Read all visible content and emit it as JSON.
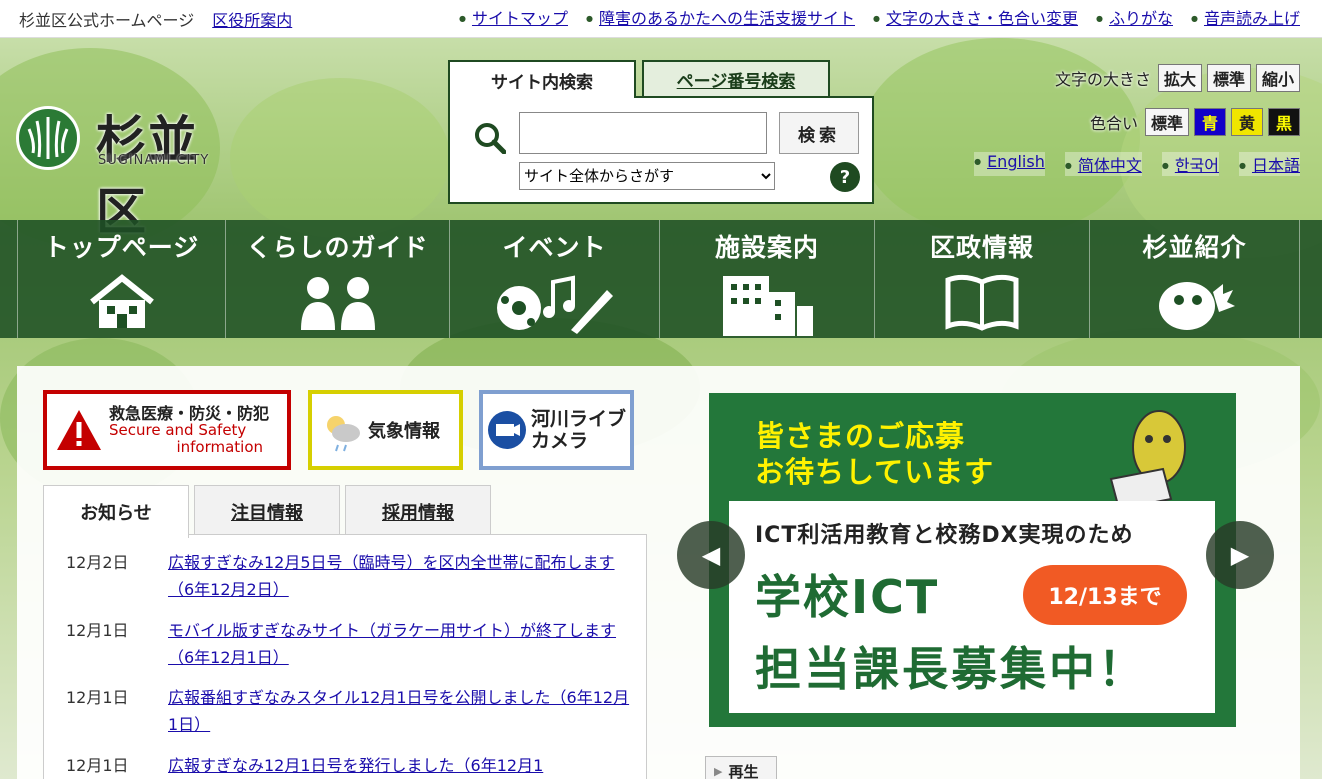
{
  "topbar": {
    "site_name": "杉並区公式ホームページ",
    "office_guide": "区役所案内",
    "links": [
      "サイトマップ",
      "障害のあるかたへの生活支援サイト",
      "文字の大きさ・色合い変更",
      "ふりがな",
      "音声読み上げ"
    ]
  },
  "logo": {
    "name": "杉並区",
    "sub": "SUGINAMI CITY"
  },
  "search": {
    "tab_site": "サイト内検索",
    "tab_page": "ページ番号検索",
    "input_value": "",
    "button": "検索",
    "scope_selected": "サイト全体からさがす",
    "help": "?"
  },
  "font_size": {
    "label": "文字の大きさ",
    "options": [
      "拡大",
      "標準",
      "縮小"
    ]
  },
  "color_scheme": {
    "label": "色合い",
    "options": [
      "標準",
      "青",
      "黄",
      "黒"
    ]
  },
  "languages": [
    "English",
    "简体中文",
    "한국어",
    "日本語"
  ],
  "gnav": [
    {
      "label": "トップページ",
      "icon": "house-icon"
    },
    {
      "label": "くらしのガイド",
      "icon": "people-icon"
    },
    {
      "label": "イベント",
      "icon": "ball-music-pencil-icon"
    },
    {
      "label": "施設案内",
      "icon": "buildings-icon"
    },
    {
      "label": "区政情報",
      "icon": "book-icon"
    },
    {
      "label": "杉並紹介",
      "icon": "mascot-icon"
    }
  ],
  "banners": {
    "emergency": {
      "line1": "救急医療・防災・防犯",
      "line2": "Secure and Safety",
      "line3": "information"
    },
    "weather": "気象情報",
    "river": {
      "line1": "河川ライブ",
      "line2": "カメラ"
    }
  },
  "news_tabs": [
    "お知らせ",
    "注目情報",
    "採用情報"
  ],
  "news": [
    {
      "date": "12月2日",
      "title": "広報すぎなみ12月5日号（臨時号）を区内全世帯に配布します（6年12月2日）"
    },
    {
      "date": "12月1日",
      "title": "モバイル版すぎなみサイト（ガラケー用サイト）が終了します（6年12月1日）"
    },
    {
      "date": "12月1日",
      "title": "広報番組すぎなみスタイル12月1日号を公開しました（6年12月1日）"
    },
    {
      "date": "12月1日",
      "title": "広報すぎなみ12月1日号を発行しました（6年12月1"
    }
  ],
  "slider": {
    "headline1": "皆さまのご応募",
    "headline2": "お待ちしています",
    "subtitle": "ICT利活用教育と校務DX実現のため",
    "title1": "学校ICT",
    "title2": "担当課長募集中！",
    "deadline": "12/13まで",
    "prev": "◀",
    "next": "▶",
    "play": "再生"
  }
}
